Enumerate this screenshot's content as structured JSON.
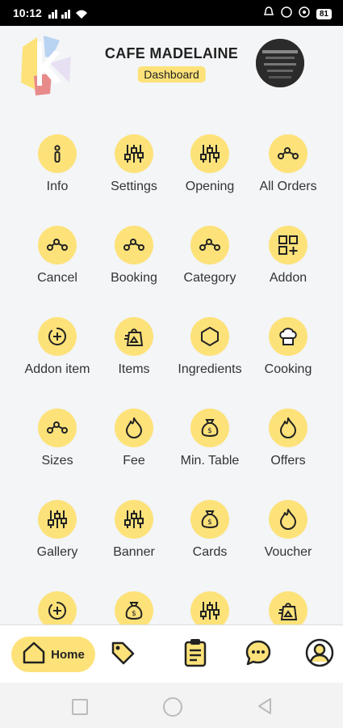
{
  "status": {
    "time": "10:12",
    "battery": "81"
  },
  "header": {
    "cafe_name": "CAFE MADELAINE",
    "badge": "Dashboard"
  },
  "tiles": [
    {
      "label": "Info",
      "icon": "info-icon"
    },
    {
      "label": "Settings",
      "icon": "sliders-icon"
    },
    {
      "label": "Opening",
      "icon": "sliders-icon"
    },
    {
      "label": "All Orders",
      "icon": "nodes-icon"
    },
    {
      "label": "Cancel",
      "icon": "nodes-icon"
    },
    {
      "label": "Booking",
      "icon": "nodes-icon"
    },
    {
      "label": "Category",
      "icon": "nodes-icon"
    },
    {
      "label": "Addon",
      "icon": "grid-plus-icon"
    },
    {
      "label": "Addon item",
      "icon": "circle-plus-icon"
    },
    {
      "label": "Items",
      "icon": "bag-icon"
    },
    {
      "label": "Ingredients",
      "icon": "hexagon-icon"
    },
    {
      "label": "Cooking",
      "icon": "chef-hat-icon"
    },
    {
      "label": "Sizes",
      "icon": "nodes-icon"
    },
    {
      "label": "Fee",
      "icon": "flame-icon"
    },
    {
      "label": "Min. Table",
      "icon": "money-bag-icon"
    },
    {
      "label": "Offers",
      "icon": "flame-icon"
    },
    {
      "label": "Gallery",
      "icon": "sliders-icon"
    },
    {
      "label": "Banner",
      "icon": "sliders-icon"
    },
    {
      "label": "Cards",
      "icon": "money-bag-icon"
    },
    {
      "label": "Voucher",
      "icon": "flame-icon"
    },
    {
      "label": "",
      "icon": "circle-plus-icon"
    },
    {
      "label": "",
      "icon": "money-bag-icon"
    },
    {
      "label": "",
      "icon": "sliders-icon"
    },
    {
      "label": "",
      "icon": "bag-icon"
    }
  ],
  "nav": {
    "home_label": "Home"
  },
  "colors": {
    "accent": "#fde27a"
  }
}
